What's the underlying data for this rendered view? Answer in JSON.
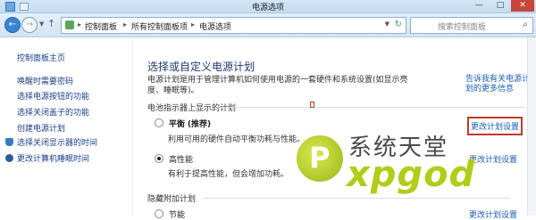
{
  "window": {
    "title": "电源选项",
    "min": "—",
    "max": "□",
    "close": "✕"
  },
  "address": {
    "crumbs": [
      "控制面板",
      "所有控制面板项",
      "电源选项"
    ],
    "search_placeholder": "搜索控制面板"
  },
  "sidebar": {
    "items": [
      {
        "label": "控制面板主页"
      },
      {
        "label": "唤醒时需要密码"
      },
      {
        "label": "选择电源按钮的功能"
      },
      {
        "label": "选择关闭盖子的功能"
      },
      {
        "label": "创建电源计划"
      },
      {
        "label": "选择关闭显示器的时间"
      },
      {
        "label": "更改计算机睡眠时间"
      }
    ]
  },
  "main": {
    "heading": "选择或自定义电源计划",
    "description": "电源计划是用于管理计算机如何使用电源的一套硬件和系统设置(如显示亮度、睡眠等)。",
    "learn_more": "告诉我有关电源计划的更多信息",
    "section_battery": "电池指示器上显示的计划",
    "section_hidden": "隐藏附加计划",
    "plans": [
      {
        "name": "平衡",
        "tag": "(推荐)",
        "desc": "利用可用的硬件自动平衡功耗与性能。",
        "selected": false,
        "change": "更改计划设置"
      },
      {
        "name": "高性能",
        "tag": "",
        "desc": "有利于提高性能，但会增加功耗。",
        "selected": true,
        "change": "更改计划设置"
      }
    ],
    "hidden_plan_partial": "节能",
    "hidden_change_partial": "更改计划设置"
  },
  "watermark": {
    "cn": "系统天堂",
    "en": "xpgod",
    "logo_letter": "P"
  },
  "colors": {
    "link": "#1a5bb5",
    "highlight_box": "#c0392b",
    "accent": "#3a83d3"
  }
}
